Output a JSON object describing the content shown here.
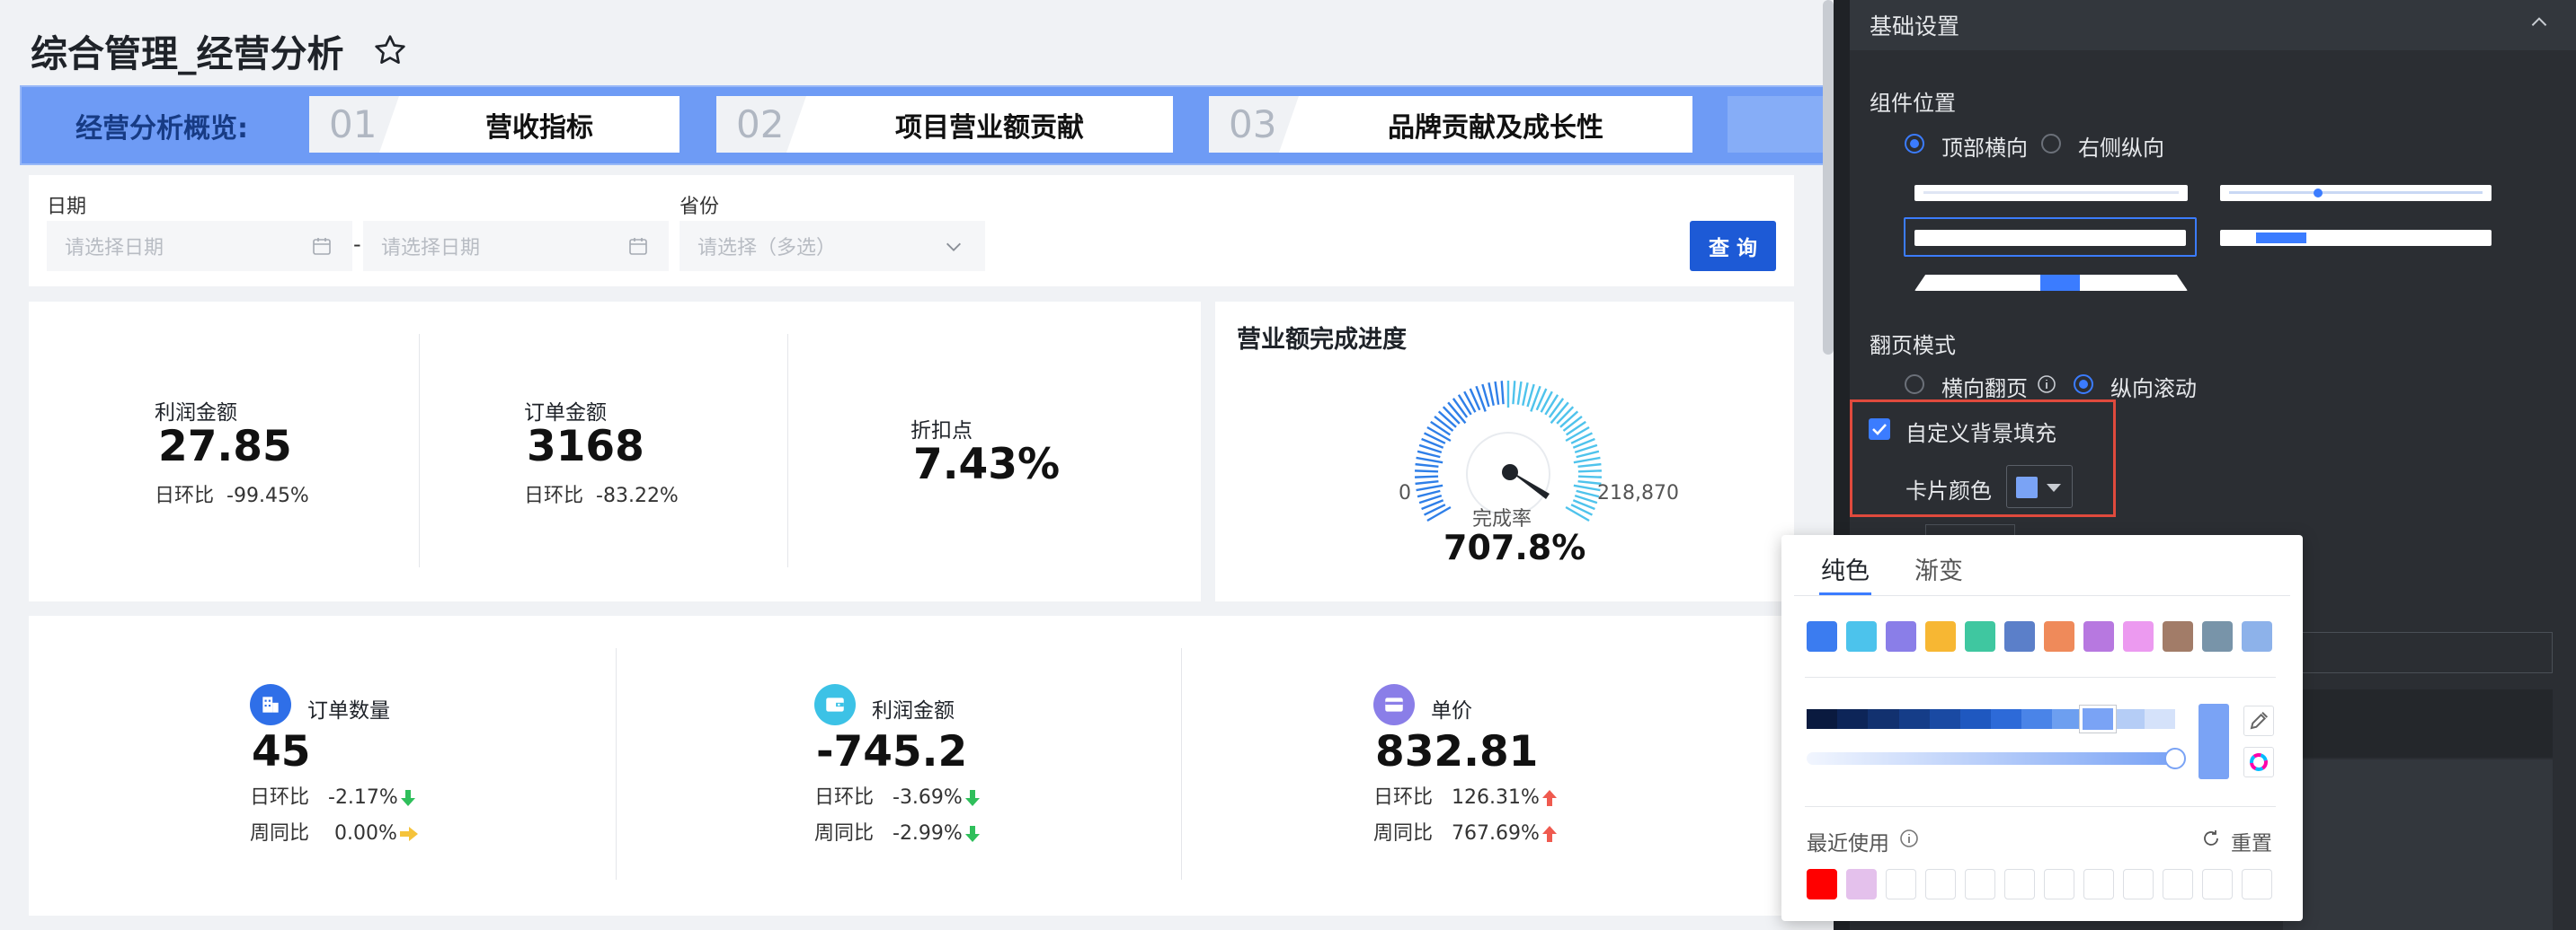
{
  "page": {
    "title": "综合管理_经营分析"
  },
  "nav": {
    "overview_label": "经营分析概览:",
    "tabs": [
      {
        "num": "01",
        "label": "营收指标"
      },
      {
        "num": "02",
        "label": "项目营业额贡献"
      },
      {
        "num": "03",
        "label": "品牌贡献及成长性"
      }
    ]
  },
  "filters": {
    "date_label": "日期",
    "start_placeholder": "请选择日期",
    "dash": "-",
    "end_placeholder": "请选择日期",
    "province_label": "省份",
    "province_placeholder": "请选择（多选）",
    "query_button": "查 询"
  },
  "kpi_top": [
    {
      "label": "利润金额",
      "value": "27.85",
      "sub_label": "日环比",
      "sub_value": "-99.45%"
    },
    {
      "label": "订单金额",
      "value": "3168",
      "sub_label": "日环比",
      "sub_value": "-83.22%"
    },
    {
      "label": "折扣点",
      "value": "7.43%"
    }
  ],
  "gauge": {
    "title": "营业额完成进度",
    "min_label": "0",
    "max_label": "218,870",
    "center_label": "完成率",
    "value": "707.8%",
    "fill_fraction": 1.0
  },
  "kpi_bottom": [
    {
      "label": "订单数量",
      "value": "45",
      "row1_label": "日环比",
      "row1_value": "-2.17%",
      "row1_trend": "down",
      "row2_label": "周同比",
      "row2_value": "0.00%",
      "row2_trend": "flat"
    },
    {
      "label": "利润金额",
      "value": "-745.2",
      "row1_label": "日环比",
      "row1_value": "-3.69%",
      "row1_trend": "down",
      "row2_label": "周同比",
      "row2_value": "-2.99%",
      "row2_trend": "down"
    },
    {
      "label": "单价",
      "value": "832.81",
      "row1_label": "日环比",
      "row1_value": "126.31%",
      "row1_trend": "up",
      "row2_label": "周同比",
      "row2_value": "767.69%",
      "row2_trend": "up"
    }
  ],
  "settings": {
    "section_title": "基础设置",
    "position_label": "组件位置",
    "position_options": [
      "顶部横向",
      "右侧纵向"
    ],
    "paging_label": "翻页模式",
    "paging_options": [
      "横向翻页",
      "纵向滚动"
    ],
    "custom_bg_label": "自定义背景填充",
    "custom_bg_checked": true,
    "card_color_label": "卡片颜色"
  },
  "color_picker": {
    "tabs": [
      "纯色",
      "渐变"
    ],
    "active_tab": "纯色",
    "swatches": [
      "#3b7cf0",
      "#4cc3ec",
      "#8a7ee8",
      "#f7b733",
      "#3fc7a0",
      "#5b7fc9",
      "#ef8a5a",
      "#b778e0",
      "#ec9af0",
      "#a27c68",
      "#7894a9",
      "#8db2ea"
    ],
    "shades": [
      "#0a1a3f",
      "#0d2558",
      "#12316f",
      "#153d88",
      "#1a4aa3",
      "#1f58c0",
      "#2d6ad8",
      "#4a84e8",
      "#6d9ff0",
      "#90b6f3",
      "#b5cdf6",
      "#d5e2fa"
    ],
    "selected_color": "#7aa3f5",
    "recent_label": "最近使用",
    "reset_label": "重置",
    "recent_colors": [
      "#ff0000",
      "#e4c1ec"
    ]
  },
  "colors": {
    "accent": "#3b7cff",
    "nav_band": "#6e9bf5",
    "query_button": "#1d5ad6",
    "highlight": "#e04a3d"
  }
}
